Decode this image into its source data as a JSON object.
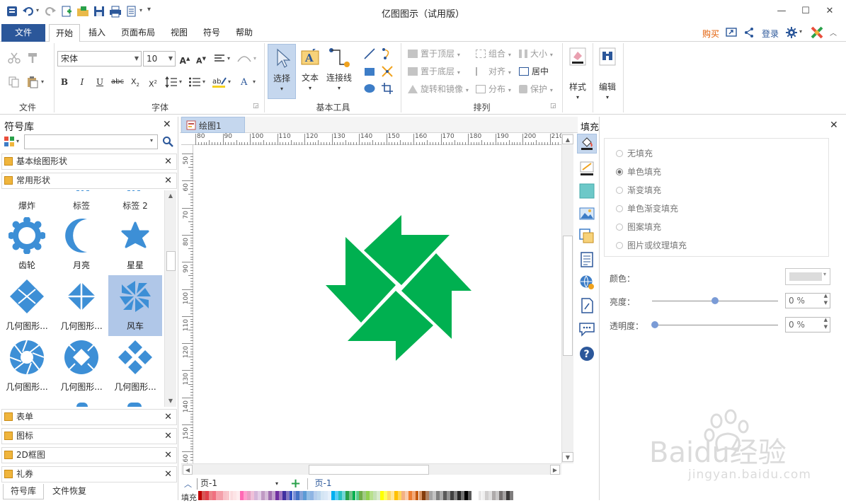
{
  "app": {
    "title": "亿图图示（试用版）"
  },
  "window": {
    "minimize": "—",
    "maximize": "☐",
    "close": "✕"
  },
  "menu": {
    "file": "文件",
    "tabs": [
      "开始",
      "插入",
      "页面布局",
      "视图",
      "符号",
      "帮助"
    ],
    "buy": "购买",
    "login": "登录"
  },
  "ribbon": {
    "groups": {
      "file": "文件",
      "font": "字体",
      "basic_tools": "基本工具",
      "arrange": "排列"
    },
    "font_name": "宋体",
    "font_size": "10",
    "tools": {
      "select": "选择",
      "text": "文本",
      "connector": "连接线"
    },
    "arrange": {
      "bring_front": "置于顶层",
      "send_back": "置于底层",
      "rotate_mirror": "旋转和镜像",
      "group": "组合",
      "align": "对齐",
      "distribute": "分布",
      "size": "大小",
      "center": "居中",
      "protect": "保护"
    },
    "style": "样式",
    "edit": "编辑"
  },
  "library": {
    "title": "符号库",
    "search_placeholder": "",
    "categories_top": [
      "基本绘图形状",
      "常用形状"
    ],
    "partial_row": [
      "爆炸",
      "标签",
      "标签 2"
    ],
    "shapes": [
      {
        "label": "齿轮",
        "icon": "gear-shape-icon"
      },
      {
        "label": "月亮",
        "icon": "moon-shape-icon"
      },
      {
        "label": "星星",
        "icon": "star-shape-icon"
      },
      {
        "label": "几何图形...",
        "icon": "geometric-diamond-icon"
      },
      {
        "label": "几何图形...",
        "icon": "geometric-diamond-cross-icon"
      },
      {
        "label": "风车",
        "icon": "pinwheel-shape-icon",
        "selected": true
      },
      {
        "label": "几何图形...",
        "icon": "aperture-shape-icon"
      },
      {
        "label": "几何图形...",
        "icon": "ring-diamond-icon"
      },
      {
        "label": "几何图形...",
        "icon": "four-diamonds-icon"
      }
    ],
    "categories_bottom": [
      "表单",
      "图标",
      "2D框图",
      "礼券"
    ],
    "bottom_tabs": [
      "符号库",
      "文件恢复"
    ]
  },
  "document": {
    "tab": "绘图1",
    "ruler_h": [
      "80",
      "90",
      "100",
      "110",
      "120",
      "130",
      "140",
      "150",
      "160",
      "170",
      "180",
      "190",
      "200",
      "210"
    ],
    "ruler_v": [
      "50",
      "60",
      "70",
      "80",
      "90",
      "100",
      "110",
      "120",
      "130",
      "140",
      "150",
      "160"
    ],
    "shape_color": "#00b050"
  },
  "page_bar": {
    "current": "页-1",
    "tab": "页-1",
    "fill_label": "填充"
  },
  "fill_panel": {
    "title": "填充",
    "options": [
      "无填充",
      "单色填充",
      "渐变填充",
      "单色渐变填充",
      "图案填充",
      "图片或纹理填充"
    ],
    "selected": "单色填充",
    "color_label": "颜色：",
    "brightness_label": "亮度：",
    "brightness_value": "0 %",
    "transparency_label": "透明度：",
    "transparency_value": "0 %"
  },
  "watermark": {
    "brand": "Baidu经验",
    "url": "jingyan.baidu.com"
  },
  "colors": {
    "accent": "#2b579a",
    "shape_blue": "#3d8fd6",
    "selected_bg": "#b0c7e8"
  }
}
